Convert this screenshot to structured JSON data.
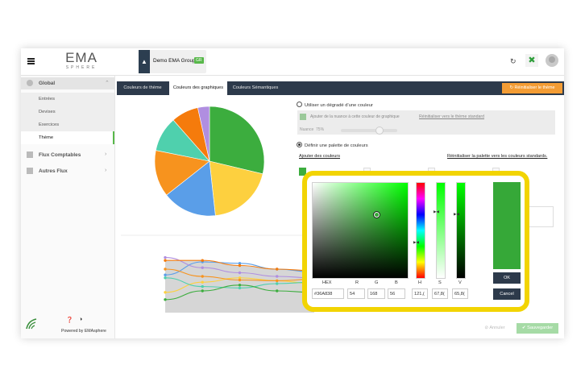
{
  "app": {
    "logo_main": "EMA",
    "logo_sub": "SPHERE",
    "group_name": "Demo EMA Group",
    "group_badge": "GR"
  },
  "sidebar": {
    "global": "Global",
    "sub_items": [
      "Entrées",
      "Devises",
      "Exercices",
      "Thème"
    ],
    "flux_comptables": "Flux Comptables",
    "autres_flux": "Autres Flux",
    "powered": "Powered by EMAsphere"
  },
  "tabs": [
    "Couleurs de thème",
    "Couleurs des graphiques",
    "Couleurs Sémantiques"
  ],
  "tab_reset": "Réinitialiser le thème",
  "options": {
    "gradient": "Utiliser un dégradé d'une couleur",
    "add_shade": "Ajouter de la nuance à cette couleur de graphique",
    "reset_standard": "Réinitialiser vers le thème standard",
    "nuance_label": "Nuance",
    "nuance_value": "75%",
    "define_palette": "Définir une palette de couleurs",
    "add_colors": "Ajouter des couleurs",
    "reset_palette": "Réinitialiser la palette vers les couleurs standards."
  },
  "footer": {
    "cancel": "Annuler",
    "save": "Sauvegarder"
  },
  "picker": {
    "labels": [
      "HEX",
      "R",
      "G",
      "B",
      "H",
      "S",
      "V"
    ],
    "values": {
      "hex": "#36A838",
      "r": "54",
      "g": "168",
      "b": "56",
      "h": "121,(",
      "s": "67,8(",
      "v": "65,8("
    },
    "ok": "OK",
    "cancel": "Cancel",
    "preview_color": "#36A838"
  },
  "chart_data": [
    {
      "type": "pie",
      "categories": [
        "",
        "",
        "",
        "",
        "",
        "",
        ""
      ],
      "values": [
        25,
        17,
        14,
        12,
        9,
        7,
        3
      ],
      "colors": [
        "#3cad3e",
        "#fdd03f",
        "#5a9ee8",
        "#f7931e",
        "#4fd0ad",
        "#f57b0c",
        "#b08ee0"
      ]
    },
    {
      "type": "line",
      "x": [
        1,
        2,
        3,
        4,
        5
      ],
      "series": [
        {
          "color": "#5a9ee8",
          "values": [
            52,
            70,
            68,
            60,
            56
          ]
        },
        {
          "color": "#b08ee0",
          "values": [
            76,
            62,
            55,
            50,
            48
          ]
        },
        {
          "color": "#f57b0c",
          "values": [
            72,
            72,
            65,
            60,
            58
          ]
        },
        {
          "color": "#fdd03f",
          "values": [
            28,
            42,
            48,
            44,
            40
          ]
        },
        {
          "color": "#4fd0ad",
          "values": [
            48,
            36,
            34,
            40,
            42
          ]
        },
        {
          "color": "#3cad3e",
          "values": [
            18,
            30,
            38,
            30,
            28
          ]
        },
        {
          "color": "#f7931e",
          "values": [
            60,
            50,
            45,
            44,
            46
          ]
        }
      ],
      "area_color": "#d6d6d6"
    }
  ]
}
